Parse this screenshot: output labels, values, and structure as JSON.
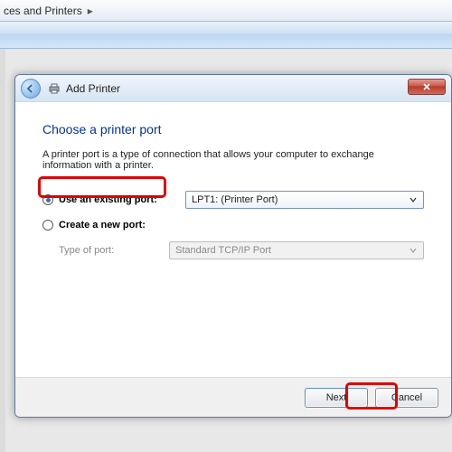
{
  "breadcrumb": {
    "text": "ces and Printers",
    "chevron": "▸"
  },
  "dialog": {
    "title": "Add Printer",
    "heading": "Choose a printer port",
    "description": "A printer port is a type of connection that allows your computer to exchange information with a printer.",
    "option_existing": {
      "label": "Use an existing port:",
      "checked": true
    },
    "option_new": {
      "label": "Create a new port:",
      "checked": false
    },
    "type_of_port_label": "Type of port:",
    "existing_port_value": "LPT1: (Printer Port)",
    "new_port_value": "Standard TCP/IP Port"
  },
  "buttons": {
    "next": "Next",
    "cancel": "Cancel"
  }
}
